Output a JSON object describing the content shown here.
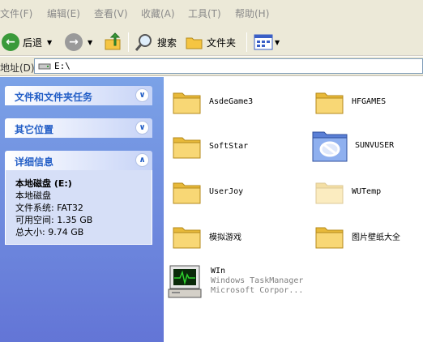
{
  "menu": [
    "文件(F)",
    "编辑(E)",
    "查看(V)",
    "收藏(A)",
    "工具(T)",
    "帮助(H)"
  ],
  "toolbar": {
    "back_label": "后退",
    "search_label": "搜索",
    "folders_label": "文件夹"
  },
  "address": {
    "label": "地址(D)",
    "value": "E:\\"
  },
  "left_pane": {
    "tasks_title": "文件和文件夹任务",
    "other_title": "其它位置",
    "details_title": "详细信息",
    "details": {
      "name": "本地磁盘 (E:)",
      "type": "本地磁盘",
      "filesystem": "文件系统: FAT32",
      "free": "可用空间: 1.35 GB",
      "total": "总大小: 9.74 GB"
    }
  },
  "items": [
    {
      "name": "AsdeGame3",
      "icon": "folder"
    },
    {
      "name": "HFGAMES",
      "icon": "folder"
    },
    {
      "name": "SoftStar",
      "icon": "folder"
    },
    {
      "name": "SUNVUSER",
      "icon": "shared-folder"
    },
    {
      "name": "UserJoy",
      "icon": "folder"
    },
    {
      "name": "WUTemp",
      "icon": "hidden-folder"
    },
    {
      "name": "模拟游戏",
      "icon": "folder"
    },
    {
      "name": "图片壁纸大全",
      "icon": "folder"
    },
    {
      "name": "WIn",
      "line2": "Windows TaskManager",
      "line3": "Microsoft Corpor...",
      "icon": "task-manager-app"
    }
  ],
  "colors": {
    "pane_gradient_top": "#7ba2e7",
    "pane_gradient_bottom": "#6375d6",
    "pane_title": "#215dc6",
    "folder_yellow": "#f8d775"
  }
}
